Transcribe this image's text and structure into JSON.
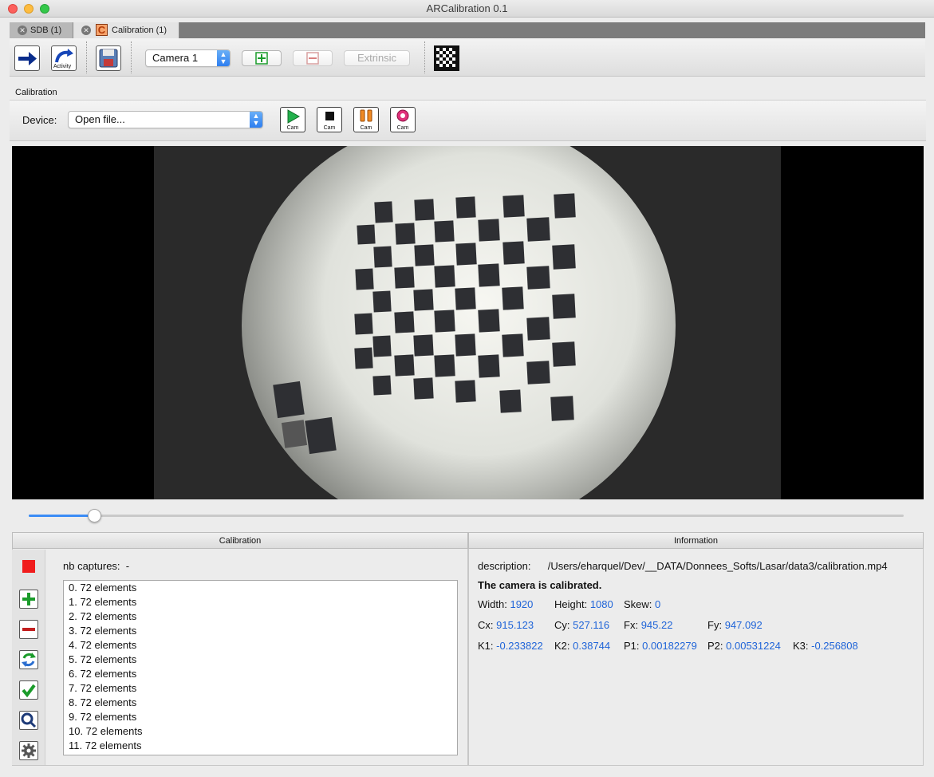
{
  "window": {
    "title": "ARCalibration 0.1"
  },
  "tabs": [
    {
      "label": "SDB (1)"
    },
    {
      "label": "Calibration (1)"
    }
  ],
  "toolbar": {
    "activity_label": "Activity",
    "camera_select": "Camera 1",
    "extrinsic_label": "Extrinsic"
  },
  "calibration_group": {
    "title": "Calibration",
    "device_label": "Device:",
    "device_select": "Open file...",
    "cam_label": "Cam"
  },
  "video": {
    "slider_position": 0.075
  },
  "left_panel": {
    "title": "Calibration",
    "nb_captures_label": "nb captures:",
    "nb_captures_value": "-",
    "captures": [
      "0. 72 elements",
      "1. 72 elements",
      "2. 72 elements",
      "3. 72 elements",
      "4. 72 elements",
      "5. 72 elements",
      "6. 72 elements",
      "7. 72 elements",
      "8. 72 elements",
      "9. 72 elements",
      "10. 72 elements",
      "11. 72 elements"
    ]
  },
  "right_panel": {
    "title": "Information",
    "description_label": "description:",
    "description_value": "/Users/eharquel/Dev/__DATA/Donnees_Softs/Lasar/data3/calibration.mp4",
    "status": "The camera is calibrated.",
    "width_label": "Width:",
    "width_value": "1920",
    "height_label": "Height:",
    "height_value": "1080",
    "skew_label": "Skew:",
    "skew_value": "0",
    "cx_label": "Cx:",
    "cx_value": "915.123",
    "cy_label": "Cy:",
    "cy_value": "527.116",
    "fx_label": "Fx:",
    "fx_value": "945.22",
    "fy_label": "Fy:",
    "fy_value": "947.092",
    "k1_label": "K1:",
    "k1_value": "-0.233822",
    "k2_label": "K2:",
    "k2_value": "0.38744",
    "p1_label": "P1:",
    "p1_value": "0.00182279",
    "p2_label": "P2:",
    "p2_value": "0.00531224",
    "k3_label": "K3:",
    "k3_value": "-0.256808"
  },
  "colors": {
    "value_blue": "#1f64d8",
    "stop_red": "#f01c1c",
    "play_green": "#22b14c",
    "slider_blue": "#3b8cf6"
  }
}
